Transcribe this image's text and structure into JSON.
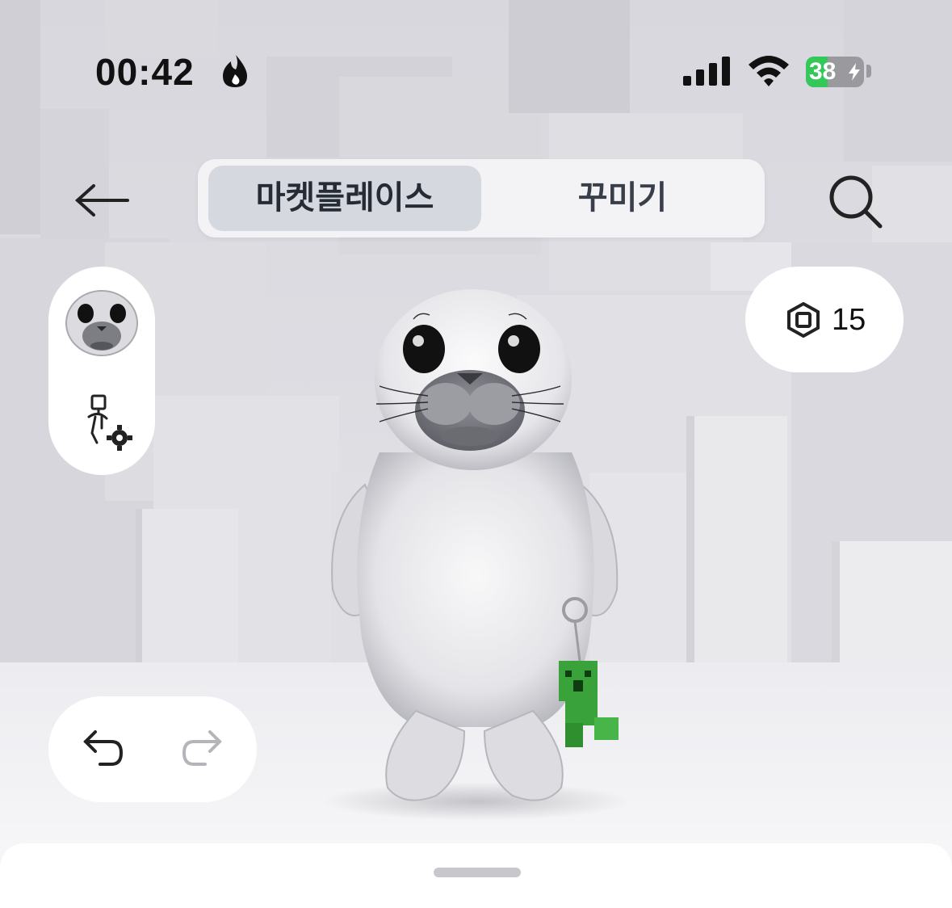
{
  "status_bar": {
    "time": "00:42",
    "battery_level": "38",
    "battery_percent": 38,
    "icons": [
      "flame-icon",
      "signal-icon",
      "wifi-icon",
      "battery-icon",
      "bolt-icon"
    ],
    "battery_color": "#34c759"
  },
  "header": {
    "back_icon": "arrow-left-icon",
    "tabs": [
      {
        "label": "마켓플레이스",
        "active": true
      },
      {
        "label": "꾸미기",
        "active": false
      }
    ],
    "search_icon": "search-icon"
  },
  "left_panel": {
    "avatar_icon": "seal-head-avatar",
    "settings_icon": "avatar-settings-icon"
  },
  "currency": {
    "icon": "robux-icon",
    "amount": "15"
  },
  "history": {
    "undo_icon": "undo-icon",
    "redo_icon": "redo-icon",
    "redo_enabled": false
  },
  "scene": {
    "character": "seal-avatar",
    "accessory": "creeper-keychain",
    "background_color": "#dcdce2",
    "accent_green": "#3aa23a"
  }
}
